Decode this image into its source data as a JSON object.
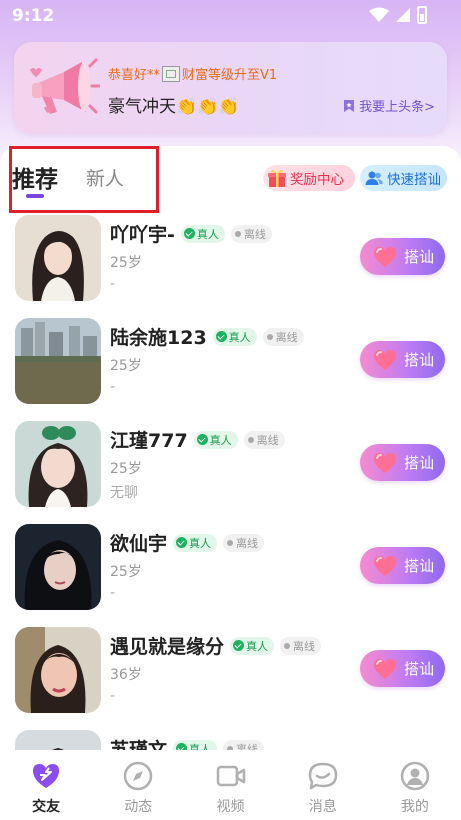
{
  "status_bar": {
    "time": "9:12"
  },
  "banner": {
    "line1_pre": "恭喜好**",
    "line1_post": "财富等级升至V1",
    "line2": "豪气冲天👏👏👏",
    "cta": "我要上头条>"
  },
  "tabs": {
    "recommend": "推荐",
    "new": "新人"
  },
  "buttons": {
    "reward_center": "奖励中心",
    "quick_chat": "快速搭讪"
  },
  "badges": {
    "real": "真人",
    "offline": "离线"
  },
  "chat_label": "搭讪",
  "users": [
    {
      "name": "吖吖宇-",
      "age": "25岁",
      "sign": "-"
    },
    {
      "name": "陆余施123",
      "age": "25岁",
      "sign": "-"
    },
    {
      "name": "江瑾777",
      "age": "25岁",
      "sign": "无聊"
    },
    {
      "name": "欲仙宇",
      "age": "25岁",
      "sign": "-"
    },
    {
      "name": "遇见就是缘分",
      "age": "36岁",
      "sign": "-"
    },
    {
      "name": "苏瑾文",
      "age": "",
      "sign": ""
    }
  ],
  "nav": [
    {
      "label": "交友",
      "icon": "heart-chat-icon",
      "active": true
    },
    {
      "label": "动态",
      "icon": "compass-icon",
      "active": false
    },
    {
      "label": "视频",
      "icon": "video-camera-icon",
      "active": false
    },
    {
      "label": "消息",
      "icon": "message-bubble-icon",
      "active": false
    },
    {
      "label": "我的",
      "icon": "profile-icon",
      "active": false
    }
  ],
  "colors": {
    "accent": "#7a44e0",
    "tab_highlight_border": "#e01f2a",
    "real_badge": "#1a9a50",
    "reward_text": "#e8314e",
    "quick_chat_text": "#1e6fd8",
    "banner_highlight": "#e96d18"
  }
}
